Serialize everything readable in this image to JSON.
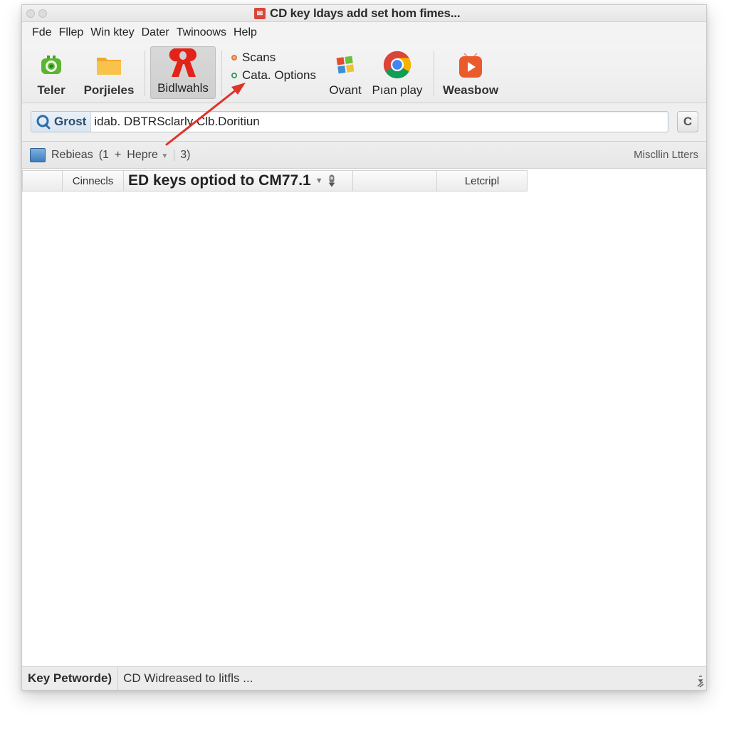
{
  "window": {
    "title": "CD key ldays add set hom fimes...",
    "title_icon": "app-icon"
  },
  "menubar": {
    "items": [
      "Fde",
      "Fllep",
      "Win ktey",
      "Dater",
      "Twinoows",
      "Help"
    ]
  },
  "toolbar": {
    "tools": [
      {
        "label": "Teler",
        "icon": "green-camera-icon"
      },
      {
        "label": "Porjieles",
        "icon": "folder-icon"
      },
      {
        "label": "Bidlwahls",
        "icon": "red-logo-icon",
        "active": true
      },
      {
        "label": "Ovant",
        "icon": "windows-logo-icon"
      },
      {
        "label": "Pıan play",
        "icon": "chrome-icon"
      },
      {
        "label": "Weasbow",
        "icon": "play-icon"
      }
    ],
    "options": [
      {
        "label": "Scans",
        "color": "#e07a3a"
      },
      {
        "label": "Cata. Options",
        "color": "#3a9a5a"
      }
    ]
  },
  "address": {
    "scope_label": "Grost",
    "value": "idab. DBTRSclarly Clb.Doritiun",
    "refresh_label": "C"
  },
  "subbar": {
    "folder_label": "Rebieas",
    "count_prefix": "(1",
    "plus": "+",
    "dropdown_label": "Hepre",
    "count_suffix": "3)",
    "right_label": "Miscllin Ltters"
  },
  "tabs": [
    {
      "label": ""
    },
    {
      "label": "Cinnecls"
    },
    {
      "label": "ED keys optiod to CM77.1"
    },
    {
      "label": ""
    },
    {
      "label": "Letcripl"
    }
  ],
  "statusbar": {
    "left": "Key Petworde)",
    "right": "CD Widreased to litfls ..."
  },
  "colors": {
    "accent_red": "#e03a2e",
    "annotation_arrow": "#e0332a"
  }
}
